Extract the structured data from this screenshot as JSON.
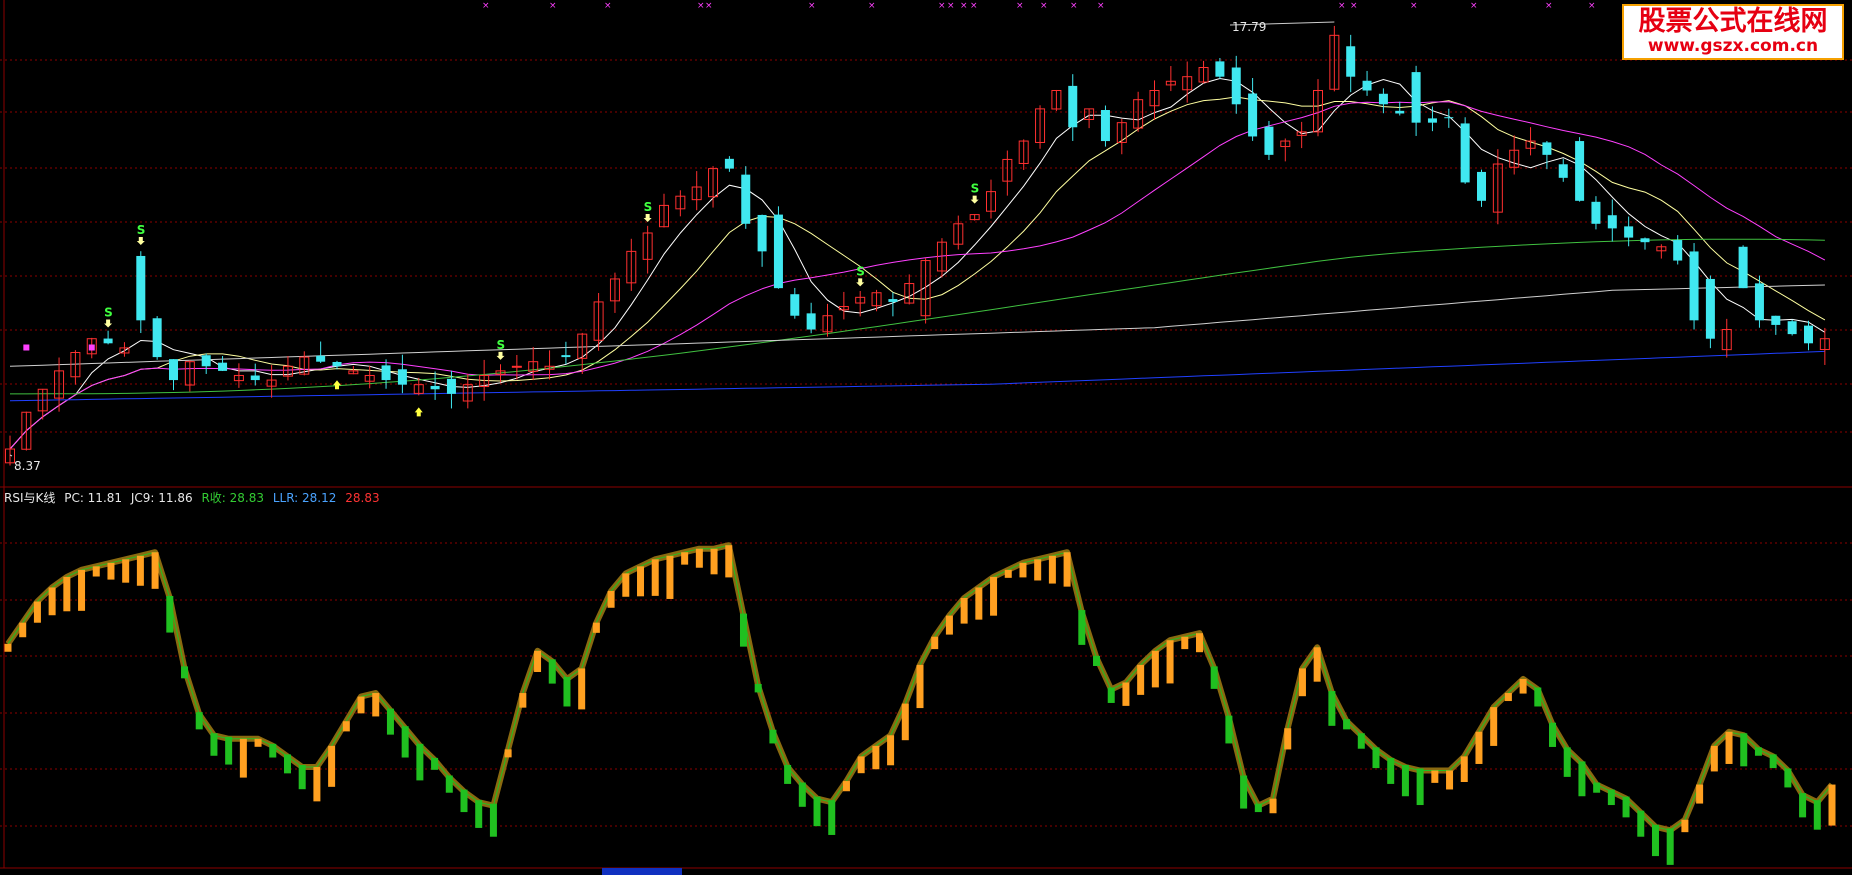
{
  "watermark": {
    "line1": "股票公式在线网",
    "line2": "www.gszx.com.cn"
  },
  "price_high_label": "17.79",
  "price_low_label": "8.37",
  "indicator": {
    "title": "RSI与K线",
    "pc": "PC: 11.81",
    "jc9": "JC9: 11.86",
    "rs": "R收: 28.83",
    "llr": "LLR: 28.12",
    "extra": "28.83"
  },
  "signal_letter": "S",
  "colors": {
    "background": "#000000",
    "grid": "#8b0000",
    "up_candle": "#ff3030",
    "down_candle": "#40e8f0",
    "ma5": "#ffffff",
    "ma10": "#ffffa0",
    "ma20": "#ff40ff",
    "ma60": "#40c040",
    "ma120": "#d0d0d0",
    "ma250": "#2040ff",
    "rsi_up": "#ffa020",
    "rsi_down": "#20c020",
    "rsi_band": "#8a6a10",
    "signal": "#40ff40"
  },
  "chart_data": [
    {
      "type": "candlestick",
      "title": "",
      "ylim": [
        8.37,
        17.79
      ],
      "high": 17.79,
      "low": 8.37,
      "signals_at_bars": [
        6,
        8,
        30,
        39,
        52,
        59
      ],
      "candles_count": 112
    },
    {
      "type": "bar",
      "title": "RSI与K线",
      "series": [
        {
          "name": "PC",
          "last": 11.81
        },
        {
          "name": "JC9",
          "last": 11.86
        },
        {
          "name": "R收",
          "last": 28.83
        },
        {
          "name": "LLR",
          "last": 28.12
        }
      ],
      "rsi_path": [
        62,
        68,
        74,
        78,
        81,
        83,
        84,
        85,
        86,
        87,
        88,
        75,
        55,
        42,
        36,
        35,
        35,
        35,
        33,
        30,
        27,
        27,
        33,
        40,
        47,
        48,
        43,
        38,
        33,
        29,
        24,
        20,
        17,
        16,
        32,
        48,
        60,
        57,
        52,
        55,
        68,
        77,
        82,
        84,
        86,
        87,
        88,
        89,
        89,
        90,
        70,
        50,
        37,
        27,
        22,
        18,
        17,
        23,
        30,
        33,
        36,
        45,
        56,
        64,
        70,
        75,
        78,
        81,
        83,
        85,
        86,
        87,
        88,
        71,
        58,
        49,
        51,
        56,
        60,
        63,
        64,
        65,
        55,
        41,
        24,
        16,
        18,
        38,
        55,
        61,
        48,
        40,
        36,
        32,
        29,
        27,
        26,
        26,
        26,
        30,
        37,
        44,
        48,
        52,
        49,
        39,
        32,
        28,
        22,
        20,
        18,
        14,
        10,
        9,
        12,
        22,
        33,
        37,
        36,
        32,
        30,
        26,
        19,
        17,
        22
      ]
    }
  ]
}
